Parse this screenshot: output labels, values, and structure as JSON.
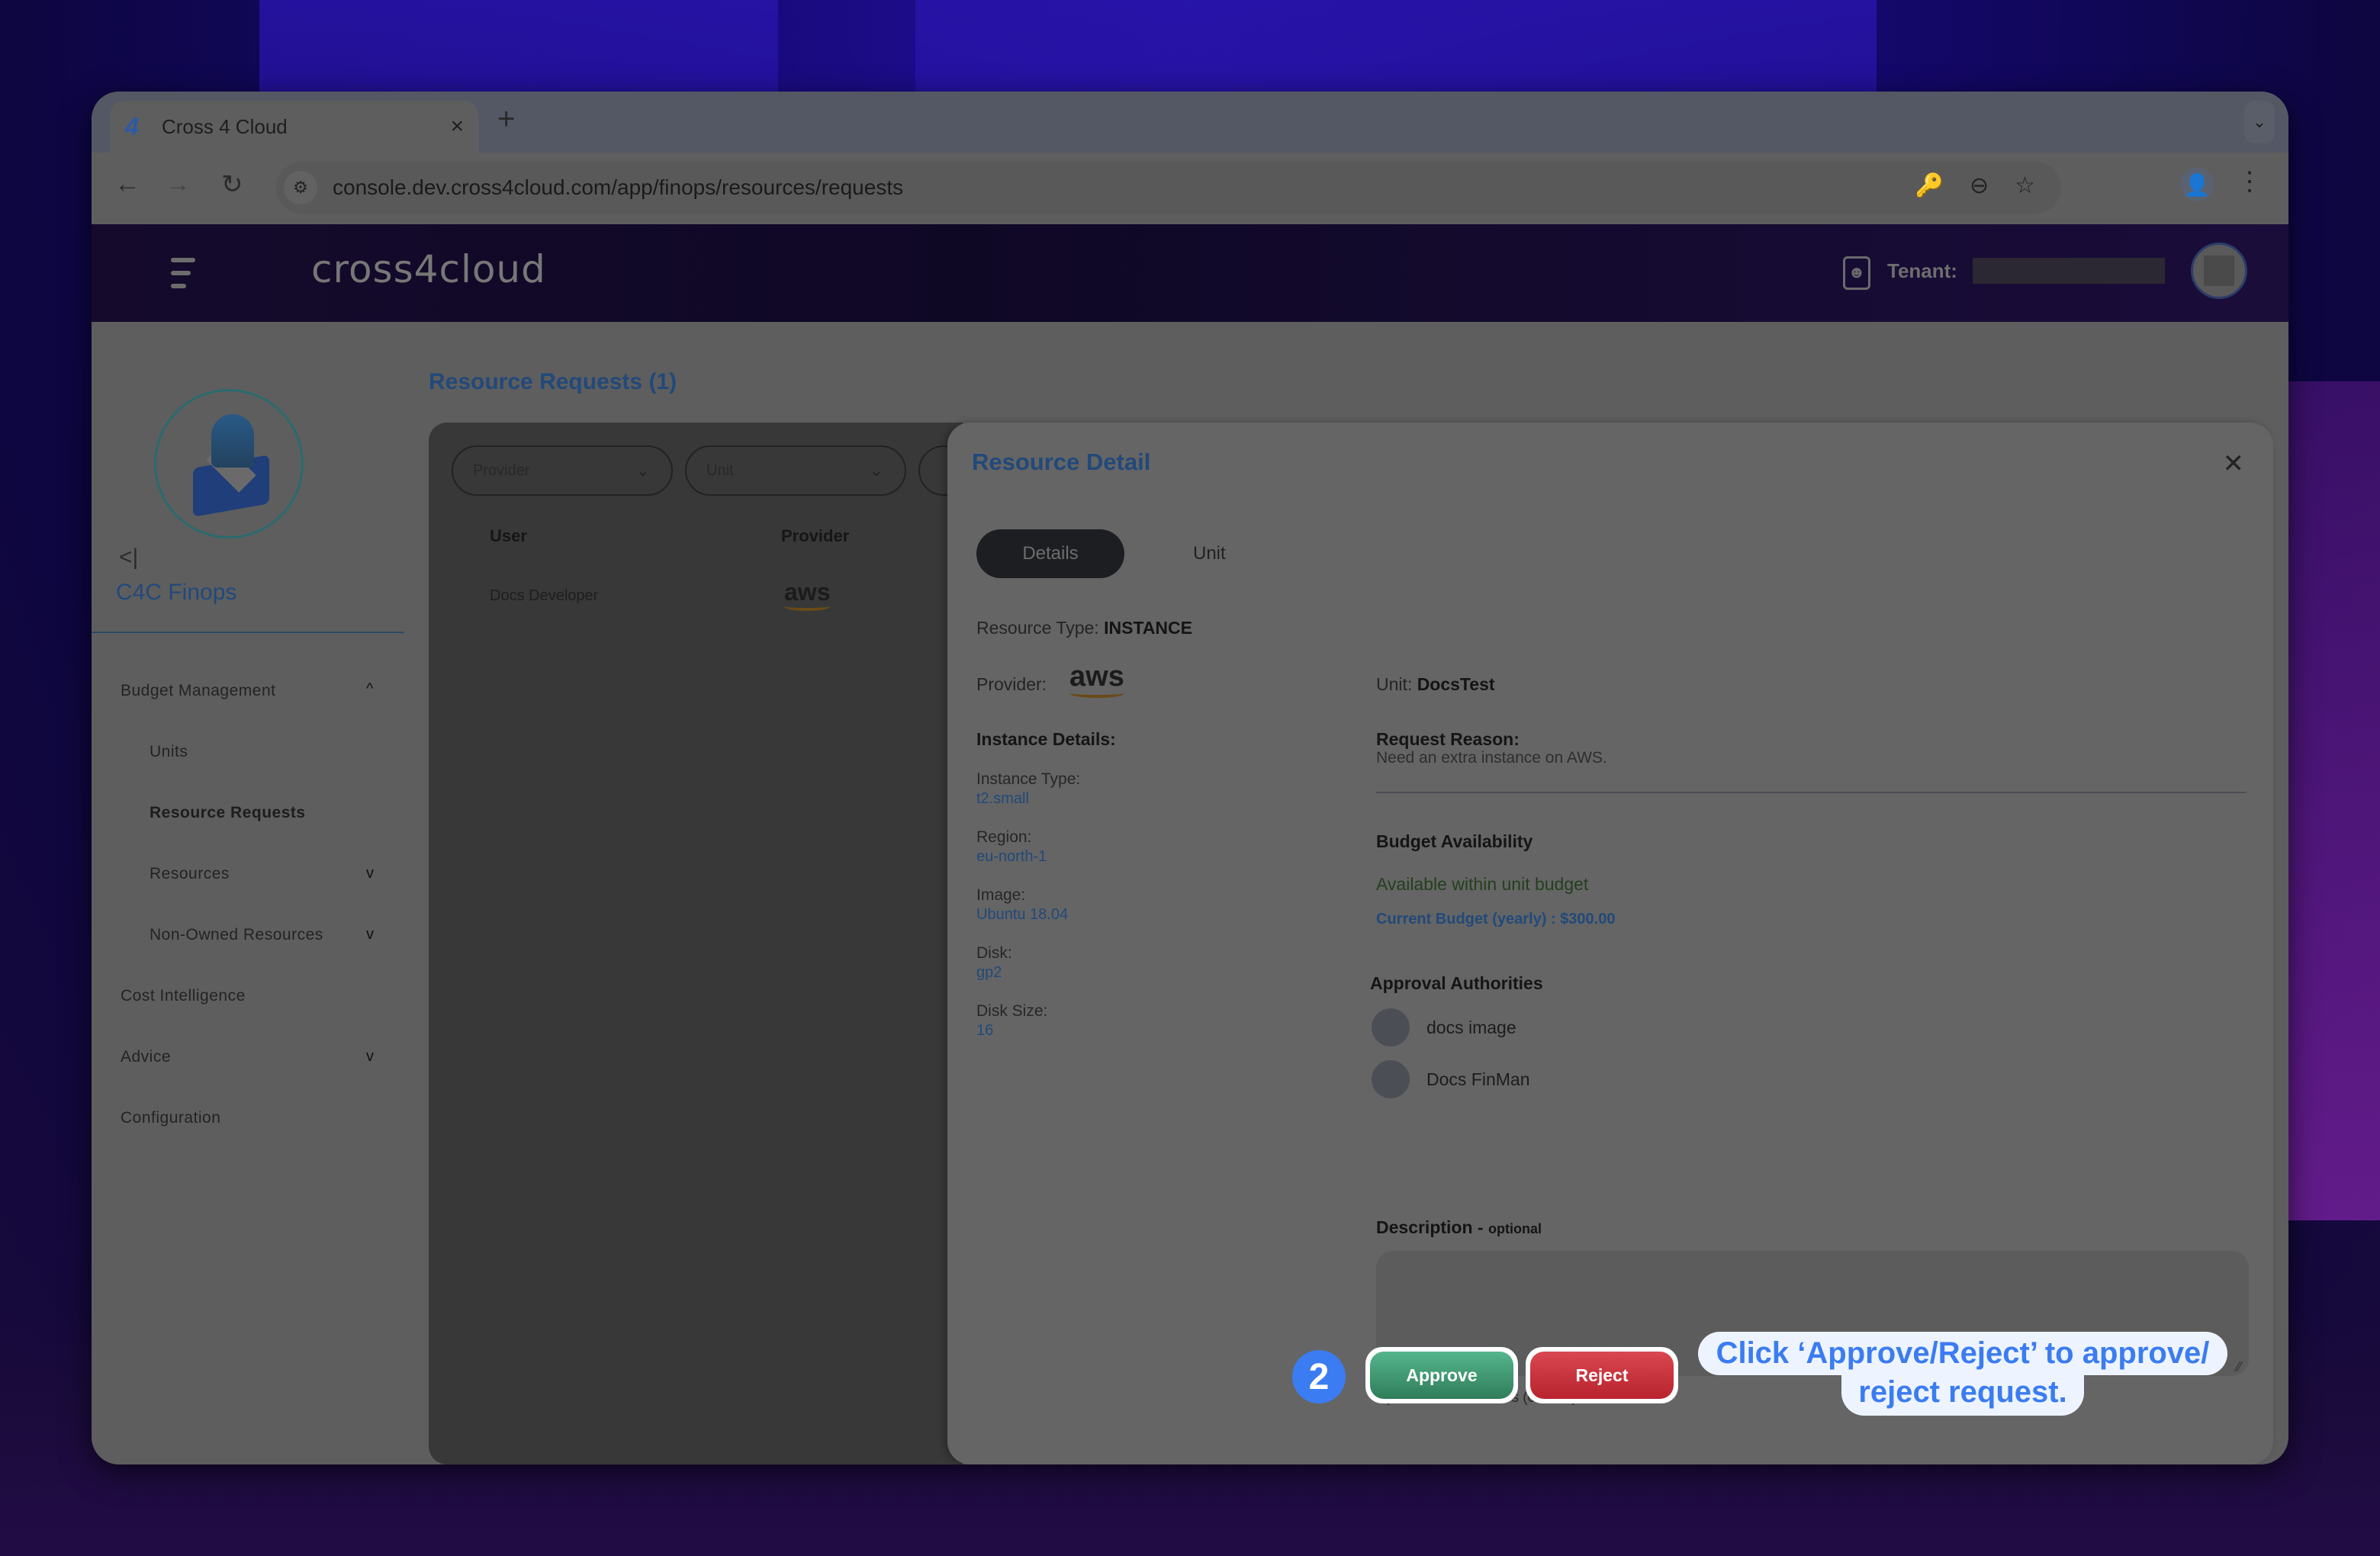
{
  "browser": {
    "tab_title": "Cross 4 Cloud",
    "tab_favicon": "4",
    "url": "console.dev.cross4cloud.com/app/finops/resources/requests",
    "icons": {
      "back": "←",
      "forward": "→",
      "reload": "↻",
      "site_info": "⚙",
      "key": "🔑",
      "zoom": "⊖",
      "star": "☆",
      "profile": "👤",
      "menu": "⋮",
      "close_tab": "×",
      "new_tab": "+",
      "tab_search": "⌄"
    }
  },
  "header": {
    "brand": "cross4cloud",
    "tenant_label": "Tenant:",
    "tenant_value": ""
  },
  "sidebar": {
    "collapse_glyph": "<|",
    "title": "C4C Finops",
    "items": [
      {
        "label": "Budget Management",
        "chevron": "^",
        "level": 0
      },
      {
        "label": "Units",
        "level": 1
      },
      {
        "label": "Resource Requests",
        "level": 1,
        "active": true
      },
      {
        "label": "Resources",
        "chevron": "v",
        "level": 1
      },
      {
        "label": "Non-Owned Resources",
        "chevron": "v",
        "level": 1
      },
      {
        "label": "Cost Intelligence",
        "level": 0
      },
      {
        "label": "Advice",
        "chevron": "v",
        "level": 0
      },
      {
        "label": "Configuration",
        "level": 0
      }
    ]
  },
  "main": {
    "page_title": "Resource Requests (1)",
    "filters": [
      {
        "placeholder": "Provider"
      },
      {
        "placeholder": "Unit"
      }
    ],
    "columns": [
      "User",
      "Provider"
    ],
    "rows": [
      {
        "user": "Docs Developer",
        "provider": "aws"
      }
    ]
  },
  "modal": {
    "title": "Resource Detail",
    "close_glyph": "✕",
    "tabs": [
      {
        "label": "Details",
        "active": true
      },
      {
        "label": "Unit",
        "active": false
      }
    ],
    "resource_type_label": "Resource Type:",
    "resource_type": "INSTANCE",
    "provider_label": "Provider:",
    "provider_logo": "aws",
    "unit_label": "Unit:",
    "unit": "DocsTest",
    "instance_details_heading": "Instance Details:",
    "instance_details": [
      {
        "label": "Instance Type:",
        "value": "t2.small"
      },
      {
        "label": "Region:",
        "value": "eu-north-1"
      },
      {
        "label": "Image:",
        "value": "Ubuntu 18.04"
      },
      {
        "label": "Disk:",
        "value": "gp2"
      },
      {
        "label": "Disk Size:",
        "value": "16"
      }
    ],
    "request_reason_heading": "Request Reason:",
    "request_reason": "Need an extra instance on AWS.",
    "budget_heading": "Budget Availability",
    "budget_status": "Available within unit budget",
    "budget_current": "Current Budget (yearly) : $300.00",
    "approval_heading": "Approval Authorities",
    "approvers": [
      "docs image",
      "Docs FinMan"
    ],
    "description_label": "Description - ",
    "description_optional": "optional",
    "description_value": "",
    "char_count": "Up to 1024 characters (0/1024)",
    "approve_label": "Approve",
    "reject_label": "Reject"
  },
  "tutorial": {
    "step": "2",
    "callout_line1": "Click ‘Approve/Reject’ to approve/",
    "callout_line2": "reject request.",
    "colors": {
      "accent": "#3b7cf2",
      "approve": "#3a8d68",
      "reject": "#c9303a",
      "title": "#22497a"
    }
  }
}
